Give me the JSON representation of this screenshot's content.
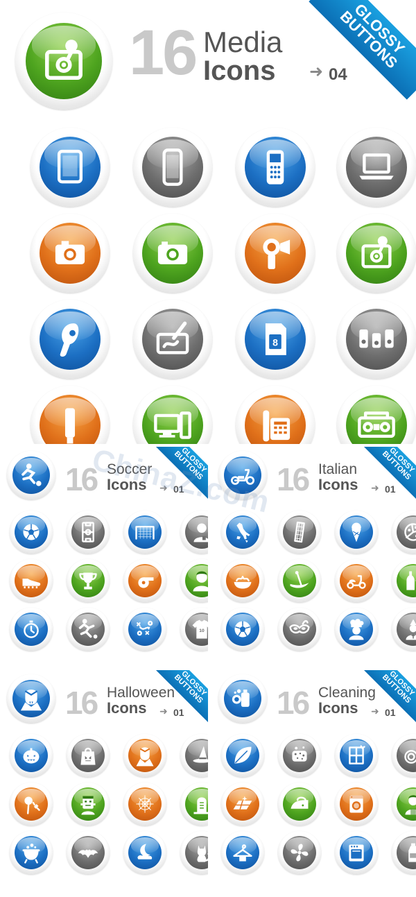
{
  "corner_badge": {
    "line1": "GLOSSY",
    "line2": "BUTTONS"
  },
  "media": {
    "count": "16",
    "word1": "Media",
    "word2": "Icons",
    "arrow": "➜",
    "version": "04",
    "rows": [
      [
        {
          "icon": "tablet-icon",
          "color": "blue"
        },
        {
          "icon": "smartphone-icon",
          "color": "gray"
        },
        {
          "icon": "cellphone-icon",
          "color": "blue"
        },
        {
          "icon": "laptop-icon",
          "color": "gray"
        }
      ],
      [
        {
          "icon": "photo-camera-icon",
          "color": "orange"
        },
        {
          "icon": "digital-camera-icon",
          "color": "green"
        },
        {
          "icon": "camcorder-icon",
          "color": "orange"
        },
        {
          "icon": "webcam-icon",
          "color": "green"
        }
      ],
      [
        {
          "icon": "bluetooth-headset-icon",
          "color": "blue"
        },
        {
          "icon": "drawing-tablet-icon",
          "color": "gray"
        },
        {
          "icon": "memory-card-icon",
          "color": "blue"
        },
        {
          "icon": "speakers-icon",
          "color": "gray"
        }
      ],
      [
        {
          "icon": "usb-stick-icon",
          "color": "orange"
        },
        {
          "icon": "desktop-computer-icon",
          "color": "green"
        },
        {
          "icon": "desk-phone-icon",
          "color": "orange"
        },
        {
          "icon": "boombox-icon",
          "color": "green"
        }
      ]
    ]
  },
  "panels": [
    {
      "count": "16",
      "word1": "Soccer",
      "word2": "Icons",
      "arrow": "➜",
      "version": "01",
      "header_icon": {
        "icon": "soccer-player-icon",
        "color": "blue"
      },
      "rows": [
        [
          {
            "icon": "soccer-ball-icon",
            "color": "blue"
          },
          {
            "icon": "soccer-field-icon",
            "color": "gray"
          },
          {
            "icon": "soccer-goal-icon",
            "color": "blue"
          },
          {
            "icon": "referee-icon",
            "color": "gray"
          }
        ],
        [
          {
            "icon": "soccer-shoe-icon",
            "color": "orange"
          },
          {
            "icon": "trophy-icon",
            "color": "green"
          },
          {
            "icon": "whistle-icon",
            "color": "orange"
          },
          {
            "icon": "player-face-icon",
            "color": "green"
          }
        ],
        [
          {
            "icon": "stopwatch-icon",
            "color": "blue"
          },
          {
            "icon": "kicking-player-icon",
            "color": "gray"
          },
          {
            "icon": "tactics-board-icon",
            "color": "blue"
          },
          {
            "icon": "jersey-icon",
            "color": "gray"
          }
        ]
      ]
    },
    {
      "count": "16",
      "word1": "Italian",
      "word2": "Icons",
      "arrow": "➜",
      "version": "01",
      "header_icon": {
        "icon": "scooter-icon",
        "color": "blue"
      },
      "rows": [
        [
          {
            "icon": "italy-map-icon",
            "color": "blue"
          },
          {
            "icon": "leaning-tower-icon",
            "color": "gray"
          },
          {
            "icon": "ice-cream-icon",
            "color": "blue"
          },
          {
            "icon": "pizza-icon",
            "color": "gray"
          }
        ],
        [
          {
            "icon": "pasta-icon",
            "color": "orange"
          },
          {
            "icon": "gondola-icon",
            "color": "green"
          },
          {
            "icon": "vespa-icon",
            "color": "orange"
          },
          {
            "icon": "wine-icon",
            "color": "green"
          }
        ],
        [
          {
            "icon": "football-icon",
            "color": "blue"
          },
          {
            "icon": "carnival-mask-icon",
            "color": "gray"
          },
          {
            "icon": "chef-icon",
            "color": "blue"
          },
          {
            "icon": "pope-icon",
            "color": "gray"
          }
        ]
      ]
    },
    {
      "count": "16",
      "word1": "Halloween",
      "word2": "Icons",
      "arrow": "➜",
      "version": "01",
      "header_icon": {
        "icon": "vampire-icon",
        "color": "blue"
      },
      "rows": [
        [
          {
            "icon": "pumpkin-icon",
            "color": "blue"
          },
          {
            "icon": "candy-bag-icon",
            "color": "gray"
          },
          {
            "icon": "dracula-icon",
            "color": "orange"
          },
          {
            "icon": "witch-hat-icon",
            "color": "gray"
          }
        ],
        [
          {
            "icon": "lollipop-icon",
            "color": "orange"
          },
          {
            "icon": "frankenstein-icon",
            "color": "green"
          },
          {
            "icon": "spider-web-icon",
            "color": "orange"
          },
          {
            "icon": "gravestone-icon",
            "color": "green"
          }
        ],
        [
          {
            "icon": "cauldron-icon",
            "color": "blue"
          },
          {
            "icon": "bat-icon",
            "color": "gray"
          },
          {
            "icon": "moon-cloud-icon",
            "color": "blue"
          },
          {
            "icon": "black-cat-icon",
            "color": "gray"
          }
        ]
      ]
    },
    {
      "count": "16",
      "word1": "Cleaning",
      "word2": "Icons",
      "arrow": "➜",
      "version": "01",
      "header_icon": {
        "icon": "detergent-icon",
        "color": "blue"
      },
      "rows": [
        [
          {
            "icon": "leaf-icon",
            "color": "blue"
          },
          {
            "icon": "sponge-icon",
            "color": "gray"
          },
          {
            "icon": "clean-window-icon",
            "color": "blue"
          },
          {
            "icon": "dishes-icon",
            "color": "gray"
          }
        ],
        [
          {
            "icon": "clean-floor-icon",
            "color": "orange"
          },
          {
            "icon": "iron-icon",
            "color": "green"
          },
          {
            "icon": "washing-machine-icon",
            "color": "orange"
          },
          {
            "icon": "housekeeper-icon",
            "color": "green"
          }
        ],
        [
          {
            "icon": "hanger-icon",
            "color": "blue"
          },
          {
            "icon": "fan-icon",
            "color": "gray"
          },
          {
            "icon": "oven-icon",
            "color": "blue"
          },
          {
            "icon": "bottle-icon",
            "color": "gray"
          }
        ]
      ]
    }
  ],
  "watermark": {
    "text": "ChinaZ.com"
  }
}
